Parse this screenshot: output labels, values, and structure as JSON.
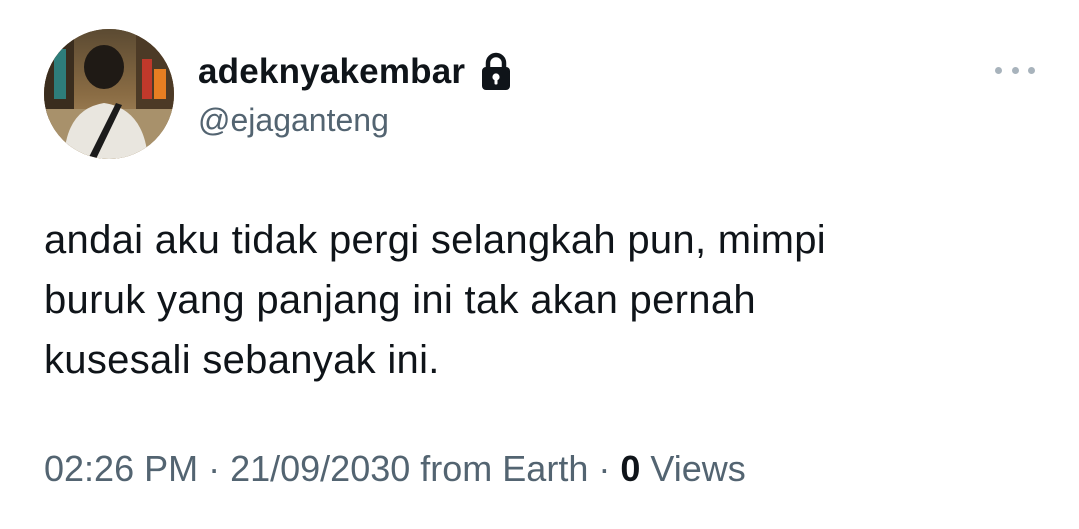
{
  "user": {
    "display_name": "adeknyakembar",
    "handle": "@ejaganteng",
    "protected_icon": "lock-icon"
  },
  "more_icon": "more-horizontal-icon",
  "tweet": {
    "lines": [
      "andai aku tidak pergi selangkah pun, mimpi",
      "buruk yang panjang ini tak akan pernah",
      "kusesali sebanyak ini."
    ]
  },
  "meta": {
    "time": "02:26 PM",
    "separator": "·",
    "date": "21/09/2030",
    "source": "from Earth",
    "views_count": "0",
    "views_label": "Views"
  },
  "colors": {
    "text_primary": "#0f1419",
    "text_secondary": "#536471",
    "more_dots": "#a8b3bc"
  }
}
